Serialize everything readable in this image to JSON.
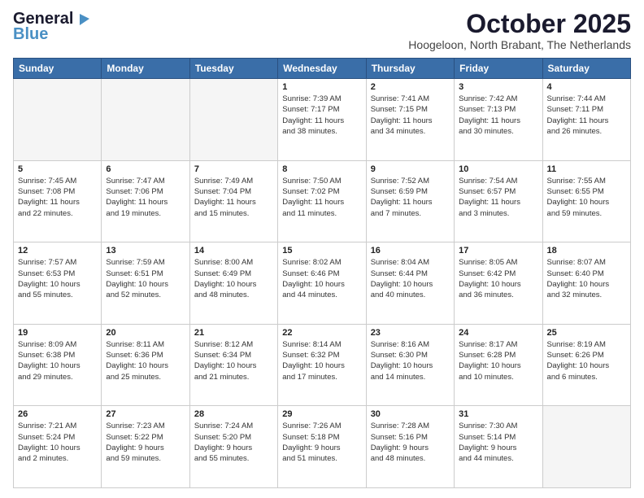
{
  "logo": {
    "line1": "General",
    "line2": "Blue"
  },
  "title": "October 2025",
  "location": "Hoogeloon, North Brabant, The Netherlands",
  "days_of_week": [
    "Sunday",
    "Monday",
    "Tuesday",
    "Wednesday",
    "Thursday",
    "Friday",
    "Saturday"
  ],
  "weeks": [
    [
      {
        "day": "",
        "info": ""
      },
      {
        "day": "",
        "info": ""
      },
      {
        "day": "",
        "info": ""
      },
      {
        "day": "1",
        "info": "Sunrise: 7:39 AM\nSunset: 7:17 PM\nDaylight: 11 hours\nand 38 minutes."
      },
      {
        "day": "2",
        "info": "Sunrise: 7:41 AM\nSunset: 7:15 PM\nDaylight: 11 hours\nand 34 minutes."
      },
      {
        "day": "3",
        "info": "Sunrise: 7:42 AM\nSunset: 7:13 PM\nDaylight: 11 hours\nand 30 minutes."
      },
      {
        "day": "4",
        "info": "Sunrise: 7:44 AM\nSunset: 7:11 PM\nDaylight: 11 hours\nand 26 minutes."
      }
    ],
    [
      {
        "day": "5",
        "info": "Sunrise: 7:45 AM\nSunset: 7:08 PM\nDaylight: 11 hours\nand 22 minutes."
      },
      {
        "day": "6",
        "info": "Sunrise: 7:47 AM\nSunset: 7:06 PM\nDaylight: 11 hours\nand 19 minutes."
      },
      {
        "day": "7",
        "info": "Sunrise: 7:49 AM\nSunset: 7:04 PM\nDaylight: 11 hours\nand 15 minutes."
      },
      {
        "day": "8",
        "info": "Sunrise: 7:50 AM\nSunset: 7:02 PM\nDaylight: 11 hours\nand 11 minutes."
      },
      {
        "day": "9",
        "info": "Sunrise: 7:52 AM\nSunset: 6:59 PM\nDaylight: 11 hours\nand 7 minutes."
      },
      {
        "day": "10",
        "info": "Sunrise: 7:54 AM\nSunset: 6:57 PM\nDaylight: 11 hours\nand 3 minutes."
      },
      {
        "day": "11",
        "info": "Sunrise: 7:55 AM\nSunset: 6:55 PM\nDaylight: 10 hours\nand 59 minutes."
      }
    ],
    [
      {
        "day": "12",
        "info": "Sunrise: 7:57 AM\nSunset: 6:53 PM\nDaylight: 10 hours\nand 55 minutes."
      },
      {
        "day": "13",
        "info": "Sunrise: 7:59 AM\nSunset: 6:51 PM\nDaylight: 10 hours\nand 52 minutes."
      },
      {
        "day": "14",
        "info": "Sunrise: 8:00 AM\nSunset: 6:49 PM\nDaylight: 10 hours\nand 48 minutes."
      },
      {
        "day": "15",
        "info": "Sunrise: 8:02 AM\nSunset: 6:46 PM\nDaylight: 10 hours\nand 44 minutes."
      },
      {
        "day": "16",
        "info": "Sunrise: 8:04 AM\nSunset: 6:44 PM\nDaylight: 10 hours\nand 40 minutes."
      },
      {
        "day": "17",
        "info": "Sunrise: 8:05 AM\nSunset: 6:42 PM\nDaylight: 10 hours\nand 36 minutes."
      },
      {
        "day": "18",
        "info": "Sunrise: 8:07 AM\nSunset: 6:40 PM\nDaylight: 10 hours\nand 32 minutes."
      }
    ],
    [
      {
        "day": "19",
        "info": "Sunrise: 8:09 AM\nSunset: 6:38 PM\nDaylight: 10 hours\nand 29 minutes."
      },
      {
        "day": "20",
        "info": "Sunrise: 8:11 AM\nSunset: 6:36 PM\nDaylight: 10 hours\nand 25 minutes."
      },
      {
        "day": "21",
        "info": "Sunrise: 8:12 AM\nSunset: 6:34 PM\nDaylight: 10 hours\nand 21 minutes."
      },
      {
        "day": "22",
        "info": "Sunrise: 8:14 AM\nSunset: 6:32 PM\nDaylight: 10 hours\nand 17 minutes."
      },
      {
        "day": "23",
        "info": "Sunrise: 8:16 AM\nSunset: 6:30 PM\nDaylight: 10 hours\nand 14 minutes."
      },
      {
        "day": "24",
        "info": "Sunrise: 8:17 AM\nSunset: 6:28 PM\nDaylight: 10 hours\nand 10 minutes."
      },
      {
        "day": "25",
        "info": "Sunrise: 8:19 AM\nSunset: 6:26 PM\nDaylight: 10 hours\nand 6 minutes."
      }
    ],
    [
      {
        "day": "26",
        "info": "Sunrise: 7:21 AM\nSunset: 5:24 PM\nDaylight: 10 hours\nand 2 minutes."
      },
      {
        "day": "27",
        "info": "Sunrise: 7:23 AM\nSunset: 5:22 PM\nDaylight: 9 hours\nand 59 minutes."
      },
      {
        "day": "28",
        "info": "Sunrise: 7:24 AM\nSunset: 5:20 PM\nDaylight: 9 hours\nand 55 minutes."
      },
      {
        "day": "29",
        "info": "Sunrise: 7:26 AM\nSunset: 5:18 PM\nDaylight: 9 hours\nand 51 minutes."
      },
      {
        "day": "30",
        "info": "Sunrise: 7:28 AM\nSunset: 5:16 PM\nDaylight: 9 hours\nand 48 minutes."
      },
      {
        "day": "31",
        "info": "Sunrise: 7:30 AM\nSunset: 5:14 PM\nDaylight: 9 hours\nand 44 minutes."
      },
      {
        "day": "",
        "info": ""
      }
    ]
  ]
}
